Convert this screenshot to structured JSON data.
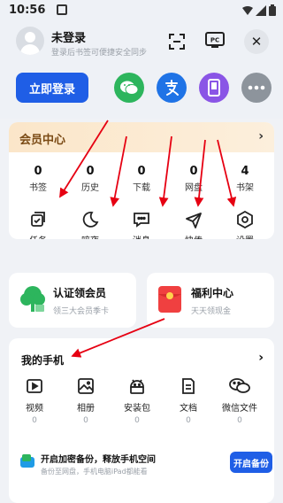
{
  "status_bar": {
    "time": "10:56"
  },
  "header": {
    "user_name": "未登录",
    "user_subtitle": "登录后书签可便捷安全同步",
    "login_button": "立即登录",
    "pc_label": "PC",
    "close_symbol": "✕"
  },
  "member": {
    "title": "会员中心",
    "stats": [
      {
        "value": "0",
        "label": "书签"
      },
      {
        "value": "0",
        "label": "历史"
      },
      {
        "value": "0",
        "label": "下载"
      },
      {
        "value": "0",
        "label": "网盘"
      },
      {
        "value": "4",
        "label": "书架"
      }
    ],
    "tools": [
      {
        "label": "任务",
        "icon": "task-icon"
      },
      {
        "label": "暗夜",
        "icon": "moon-icon"
      },
      {
        "label": "消息",
        "icon": "message-icon"
      },
      {
        "label": "快传",
        "icon": "send-icon"
      },
      {
        "label": "设置",
        "icon": "settings-icon"
      }
    ]
  },
  "promos": [
    {
      "title": "认证领会员",
      "subtitle": "领三大会员季卡",
      "icon": "tree-icon",
      "color": "#2db55d"
    },
    {
      "title": "福利中心",
      "subtitle": "天天领现金",
      "icon": "red-envelope-icon",
      "color": "#f04040"
    }
  ],
  "phone": {
    "title": "我的手机",
    "items": [
      {
        "label": "视频",
        "count": "0",
        "icon": "video-icon"
      },
      {
        "label": "相册",
        "count": "0",
        "icon": "album-icon"
      },
      {
        "label": "安装包",
        "count": "0",
        "icon": "android-icon"
      },
      {
        "label": "文档",
        "count": "0",
        "icon": "document-icon"
      },
      {
        "label": "微信文件",
        "count": "0",
        "icon": "wechat-icon"
      }
    ],
    "backup": {
      "title": "开启加密备份，释放手机空间",
      "subtitle": "备份至网盘，手机电脑iPad都能看",
      "button": "开启备份"
    }
  },
  "colors": {
    "accent": "#1f5ee6",
    "wechat": "#2db55d",
    "alipay": "#1f73e6",
    "tablet": "#8a55e6",
    "more": "#8d949c",
    "annotation_arrow": "#e60012"
  }
}
